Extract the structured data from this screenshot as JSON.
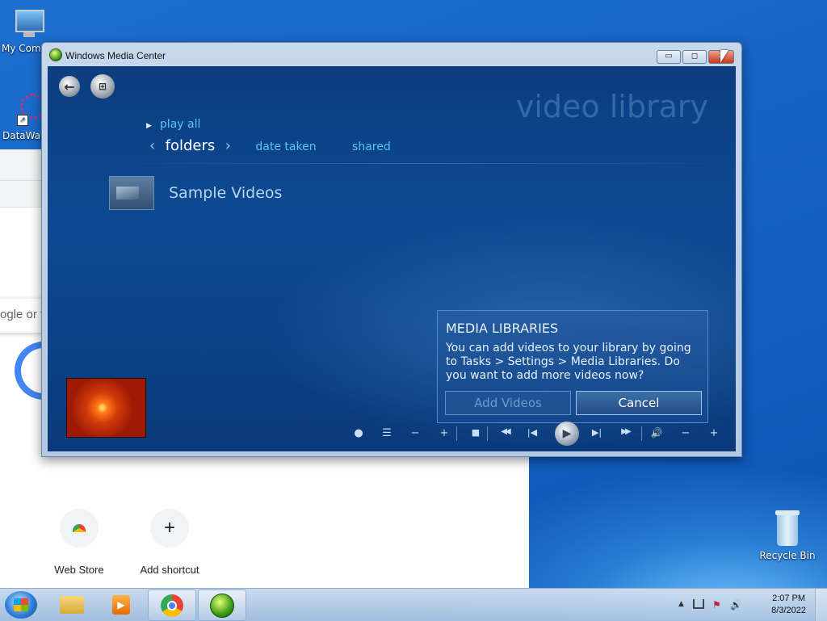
{
  "desktop": {
    "icons": [
      {
        "label": "My Comp",
        "icon": "computer-icon"
      },
      {
        "label": "DataWag",
        "icon": "datawag-shortcut-icon"
      },
      {
        "label": "Recycle Bin",
        "icon": "recycle-bin-icon"
      }
    ]
  },
  "chrome": {
    "omnibox_placeholder": "ogle or type a URL",
    "shortcuts": [
      {
        "label": "Web Store",
        "icon": "chrome-web-store-icon"
      },
      {
        "label": "Add shortcut",
        "glyph": "+"
      }
    ]
  },
  "wmc": {
    "window_title": "Windows Media Center",
    "controls": {
      "minimize": "▭",
      "maximize": "◻",
      "close": "✕"
    },
    "library_title": "video library",
    "play_all": "play all",
    "view_active": "folders",
    "view_options": [
      "date taken",
      "shared"
    ],
    "items": [
      {
        "label": "Sample Videos"
      }
    ],
    "dialog": {
      "title": "MEDIA LIBRARIES",
      "message": "You can add videos to your library by going to Tasks > Settings > Media Libraries. Do you want to add more videos now?",
      "add_button": "Add Videos",
      "cancel_button": "Cancel"
    },
    "transport": {
      "record": "●",
      "list": "☰",
      "channel_down": "−",
      "channel_up": "+",
      "stop": "■",
      "rewind": "◀◀",
      "prev": "|◀",
      "play": "▶",
      "next": "▶|",
      "fast_forward": "▶▶",
      "volume": "🔊",
      "volume_down": "−",
      "volume_up": "+"
    }
  },
  "taskbar": {
    "time": "2:07 PM",
    "date": "8/3/2022",
    "tray_arrow": "▲"
  }
}
